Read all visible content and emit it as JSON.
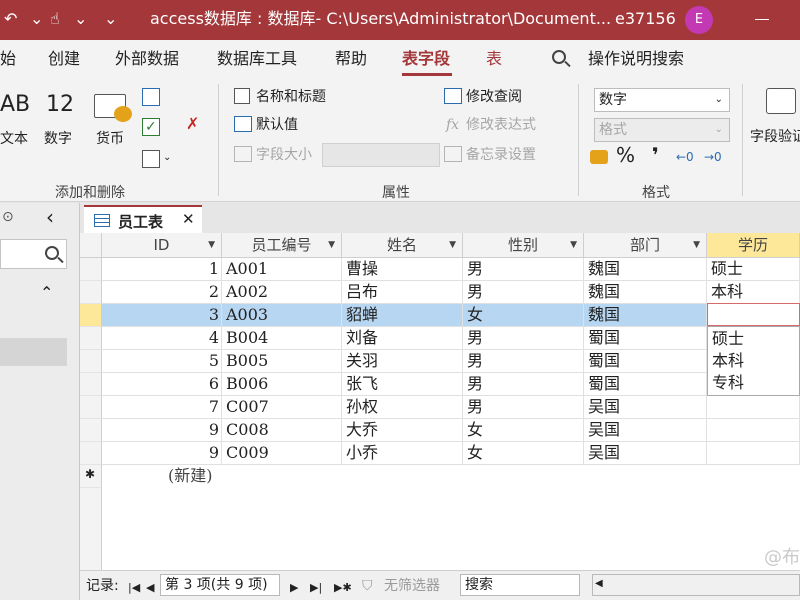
{
  "titlebar": {
    "qat_undo": "↶",
    "qat_touch": "☝",
    "qat_more": "⌄",
    "title": "access数据库 : 数据库- C:\\Users\\Administrator\\Document...",
    "user": "e37156",
    "avatar": "E"
  },
  "tabs": {
    "items": [
      "始",
      "创建",
      "外部数据",
      "数据库工具",
      "帮助",
      "表字段",
      "表",
      "操作说明搜索"
    ]
  },
  "ribbon": {
    "add_delete": {
      "text_icon": "AB",
      "text_label": "文本",
      "number_icon": "12",
      "number_label": "数字",
      "currency_label": "货币",
      "group": "添加和删除"
    },
    "properties": {
      "name_caption": "名称和标题",
      "default_value": "默认值",
      "field_size": "字段大小",
      "modify_lookup": "修改查阅",
      "modify_expression": "修改表达式",
      "memo_settings": "备忘录设置",
      "fx": "fx",
      "group": "属性"
    },
    "format": {
      "data_type": "数字",
      "format_placeholder": "格式",
      "percent": "%",
      "comma": "❜",
      "dec_inc": "←0",
      "dec_dec": "→0",
      "group": "格式"
    },
    "validation": {
      "label": "字段验证"
    }
  },
  "nav": {
    "search_icon": "search-icon",
    "collapse": "‹",
    "up": "⌃"
  },
  "doctab": {
    "label": "员工表",
    "close": "✕"
  },
  "datasheet": {
    "columns": [
      "ID",
      "员工编号",
      "姓名",
      "性别",
      "部门",
      "学历"
    ],
    "rows": [
      {
        "id": "1",
        "code": "A001",
        "name": "曹操",
        "gender": "男",
        "dept": "魏国",
        "edu": "硕士"
      },
      {
        "id": "2",
        "code": "A002",
        "name": "吕布",
        "gender": "男",
        "dept": "魏国",
        "edu": "本科"
      },
      {
        "id": "3",
        "code": "A003",
        "name": "貂蝉",
        "gender": "女",
        "dept": "魏国",
        "edu": ""
      },
      {
        "id": "4",
        "code": "B004",
        "name": "刘备",
        "gender": "男",
        "dept": "蜀国",
        "edu": ""
      },
      {
        "id": "5",
        "code": "B005",
        "name": "关羽",
        "gender": "男",
        "dept": "蜀国",
        "edu": ""
      },
      {
        "id": "6",
        "code": "B006",
        "name": "张飞",
        "gender": "男",
        "dept": "蜀国",
        "edu": ""
      },
      {
        "id": "7",
        "code": "C007",
        "name": "孙权",
        "gender": "男",
        "dept": "吴国",
        "edu": ""
      },
      {
        "id": "9",
        "code": "C008",
        "name": "大乔",
        "gender": "女",
        "dept": "吴国",
        "edu": ""
      },
      {
        "id": "9",
        "code": "C009",
        "name": "小乔",
        "gender": "女",
        "dept": "吴国",
        "edu": ""
      }
    ],
    "new_row_marker": "✱",
    "new_row_label": "(新建)",
    "dropdown_options": [
      "硕士",
      "本科",
      "专科"
    ]
  },
  "recnav": {
    "label": "记录:",
    "first": "|◀",
    "prev": "◀",
    "position": "第 3 项(共 9 项)",
    "next": "▶",
    "last": "▶|",
    "new": "▶✱",
    "no_filter": "无筛选器",
    "search": "搜索"
  },
  "watermark": "@布"
}
